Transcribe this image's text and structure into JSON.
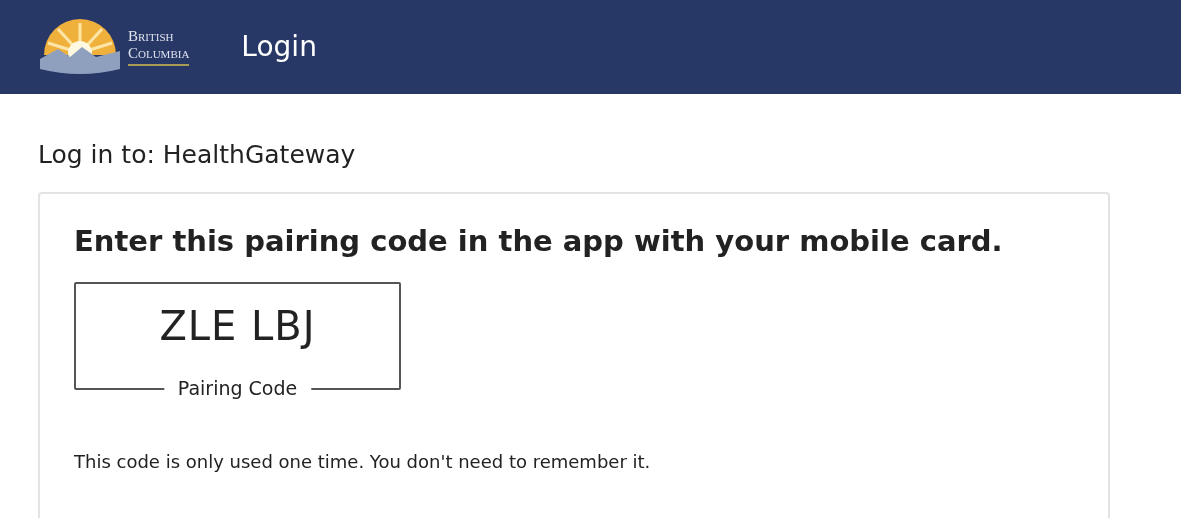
{
  "header": {
    "logo_lines": [
      "British",
      "Columbia"
    ],
    "title": "Login"
  },
  "login_target": "Log in to: HealthGateway",
  "card": {
    "heading": "Enter this pairing code in the app with your mobile card.",
    "pairing_code": {
      "value": "ZLE LBJ",
      "label": "Pairing Code"
    },
    "note": "This code is only used one time. You don't need to remember it."
  }
}
